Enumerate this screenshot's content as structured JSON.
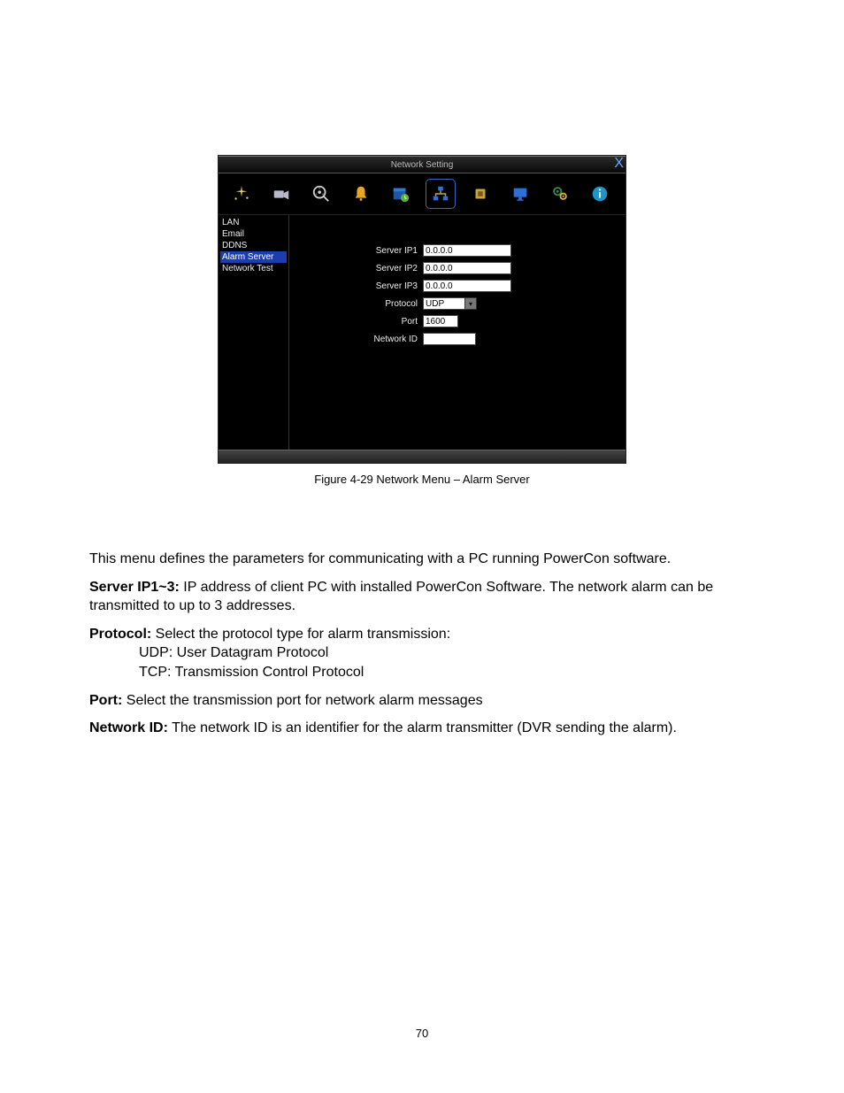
{
  "dialog": {
    "title": "Network Setting",
    "close_label": "X",
    "toolbar": {
      "icons": [
        "sparkle-icon",
        "camera-icon",
        "reel-search-icon",
        "bell-icon",
        "schedule-icon",
        "network-icon",
        "chip-icon",
        "monitor-icon",
        "gears-icon",
        "info-icon"
      ],
      "active_index": 5
    },
    "sidebar": {
      "items": [
        "LAN",
        "Email",
        "DDNS",
        "Alarm Server",
        "Network Test"
      ],
      "active_index": 3
    },
    "form": {
      "server_ip1": {
        "label": "Server IP1",
        "value": "0.0.0.0"
      },
      "server_ip2": {
        "label": "Server IP2",
        "value": "0.0.0.0"
      },
      "server_ip3": {
        "label": "Server IP3",
        "value": "0.0.0.0"
      },
      "protocol": {
        "label": "Protocol",
        "value": "UDP"
      },
      "port": {
        "label": "Port",
        "value": "1600"
      },
      "network_id": {
        "label": "Network ID",
        "value": ""
      }
    }
  },
  "caption": "Figure 4-29  Network Menu – Alarm Server",
  "doc": {
    "intro": "This menu defines the parameters for communicating with a PC running PowerCon software.",
    "server_ip_label": "Server IP1~3:",
    "server_ip_text": " IP address of client PC with installed PowerCon Software. The network alarm can be transmitted to up to 3 addresses.",
    "protocol_label": "Protocol:",
    "protocol_text": " Select the protocol type for alarm transmission:",
    "protocol_udp": "UDP: User Datagram Protocol",
    "protocol_tcp": "TCP: Transmission Control Protocol",
    "port_label": "Port:",
    "port_text": " Select the transmission port for network alarm messages",
    "network_id_label": "Network ID:",
    "network_id_text": " The network ID is an identifier for the alarm transmitter (DVR sending the alarm)."
  },
  "page_number": "70"
}
